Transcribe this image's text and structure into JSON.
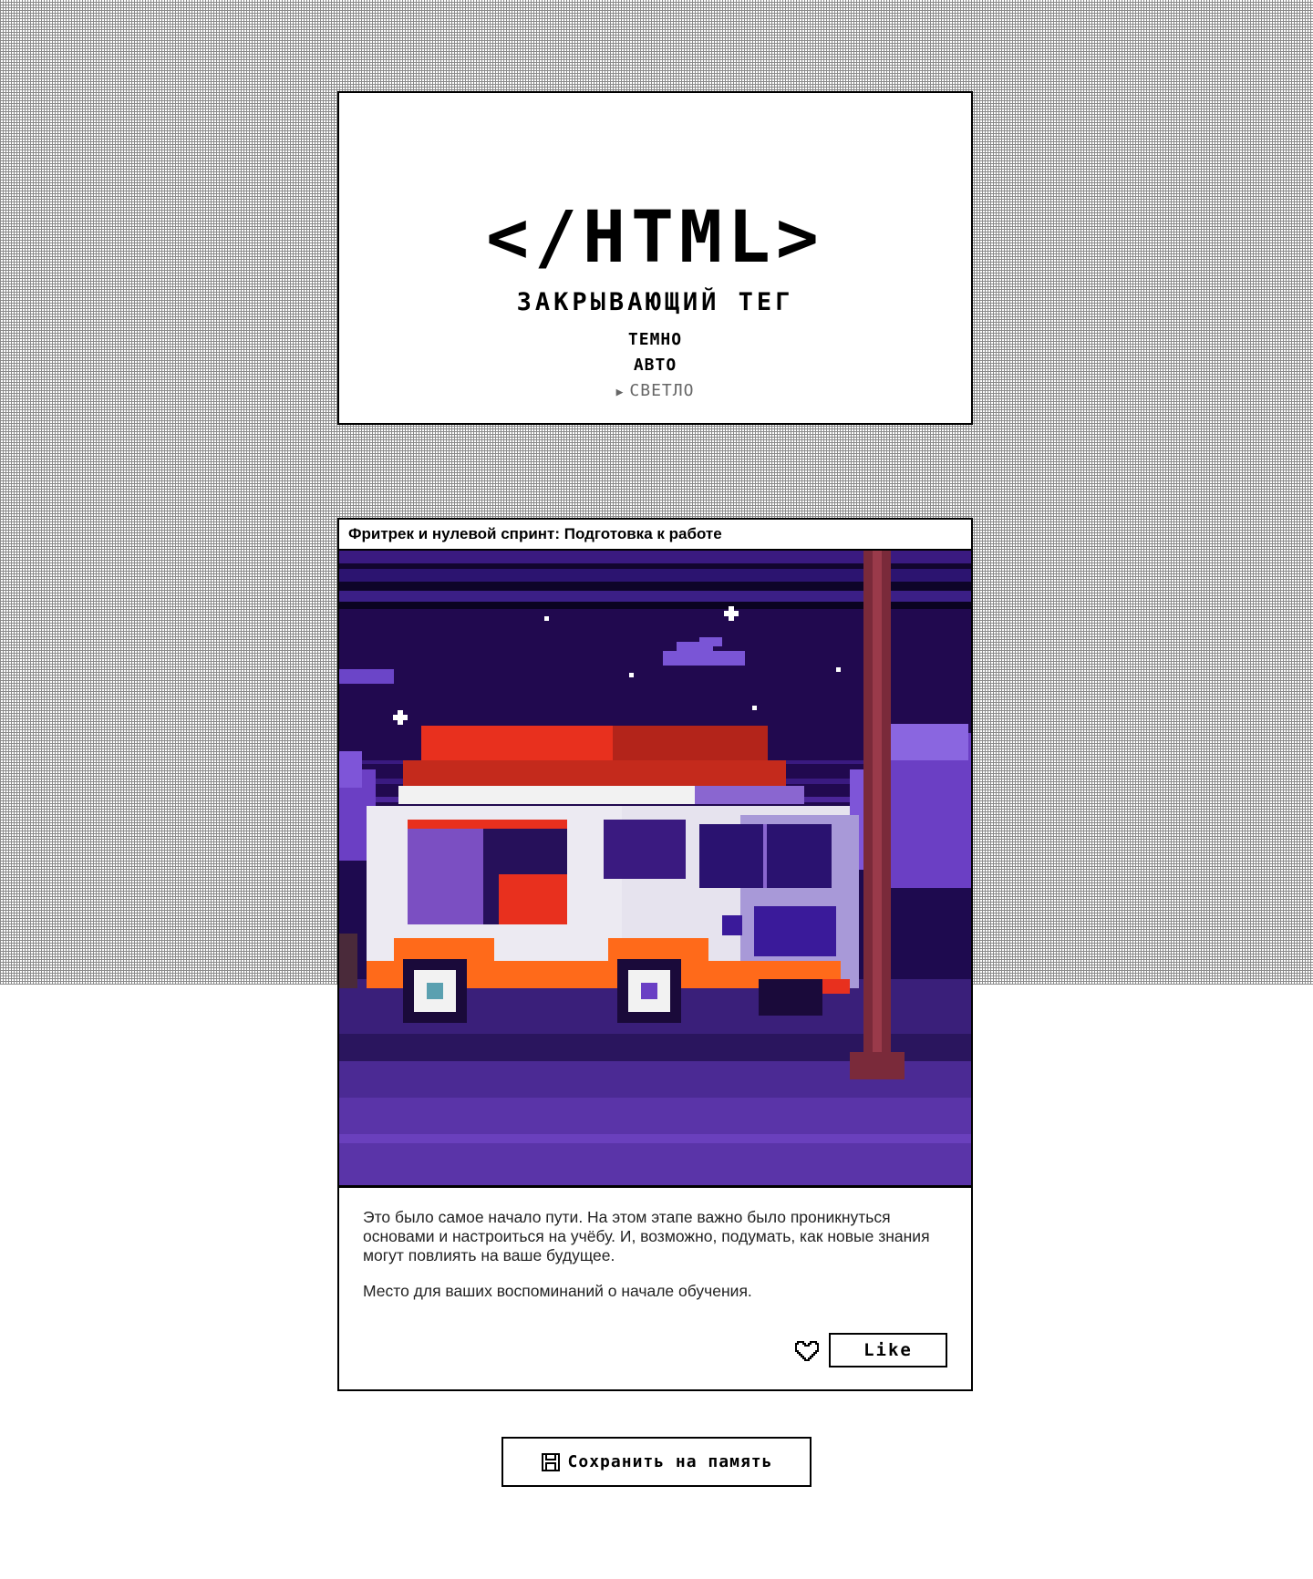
{
  "header": {
    "logo": "</HTML>",
    "subtitle": "ЗАКРЫВАЮЩИЙ ТЕГ",
    "theme_options": [
      "ТЕМНО",
      "АВТО",
      "СВЕТЛО"
    ],
    "active_theme": "СВЕТЛО",
    "active_marker_icon": "triangle-right-icon"
  },
  "card": {
    "title": "Фритрек и нулевой спринт: Подготовка к работе",
    "image_icon": "pixel-art-food-truck-illustration",
    "paragraphs": [
      "Это было самое начало пути. На этом этапе важно было проникнуться основами и настроиться на учёбу. И, возможно, подумать, как новые знания могут повлиять на ваше будущее.",
      "Место для ваших воспоминаний о начале обучения."
    ],
    "like_icon": "heart-icon",
    "like_label": "Like"
  },
  "save": {
    "icon": "floppy-disk-icon",
    "label": "Сохранить на память"
  },
  "colors": {
    "border": "#000000",
    "grid": "#8a8a8a",
    "sky": "#1e0a4f",
    "truck_red": "#e8301e",
    "truck_orange": "#ff6a1a",
    "violet": "#6b3fc4"
  }
}
